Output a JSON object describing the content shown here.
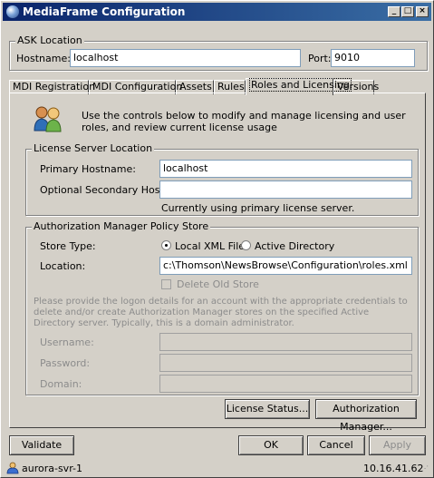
{
  "window": {
    "title": "MediaFrame Configuration"
  },
  "ask_location": {
    "group_title": "ASK Location",
    "hostname_label": "Hostname:",
    "hostname_value": "localhost",
    "port_label": "Port:",
    "port_value": "9010"
  },
  "tabs": [
    {
      "label": "MDI Registration"
    },
    {
      "label": "MDI Configuration"
    },
    {
      "label": "Assets"
    },
    {
      "label": "Rules"
    },
    {
      "label": "Roles and Licensing"
    },
    {
      "label": "Versions"
    }
  ],
  "roles_panel": {
    "intro": "Use the controls below to modify and manage licensing and user roles, and review current license usage",
    "license_server": {
      "group_title": "License Server Location",
      "primary_label": "Primary Hostname:",
      "primary_value": "localhost",
      "secondary_label": "Optional Secondary Hostname:",
      "secondary_value": "",
      "status": "Currently using primary license server."
    },
    "policy_store": {
      "group_title": "Authorization Manager Policy Store",
      "store_type_label": "Store Type:",
      "option_local": "Local XML File",
      "option_ad": "Active Directory",
      "location_label": "Location:",
      "location_value": "c:\\Thomson\\NewsBrowse\\Configuration\\roles.xml",
      "delete_old_label": "Delete Old Store",
      "logon_note": "Please provide the logon details for an account with the appropriate credentials to delete and/or create Authorization Manager stores on the specified Active Directory server. Typically, this is a domain administrator.",
      "username_label": "Username:",
      "password_label": "Password:",
      "domain_label": "Domain:"
    },
    "license_status_button": "License Status...",
    "auth_manager_button": "Authorization Manager..."
  },
  "footer": {
    "validate": "Validate",
    "ok": "OK",
    "cancel": "Cancel",
    "apply": "Apply"
  },
  "status_bar": {
    "server": "aurora-svr-1",
    "ip": "10.16.41.62"
  }
}
